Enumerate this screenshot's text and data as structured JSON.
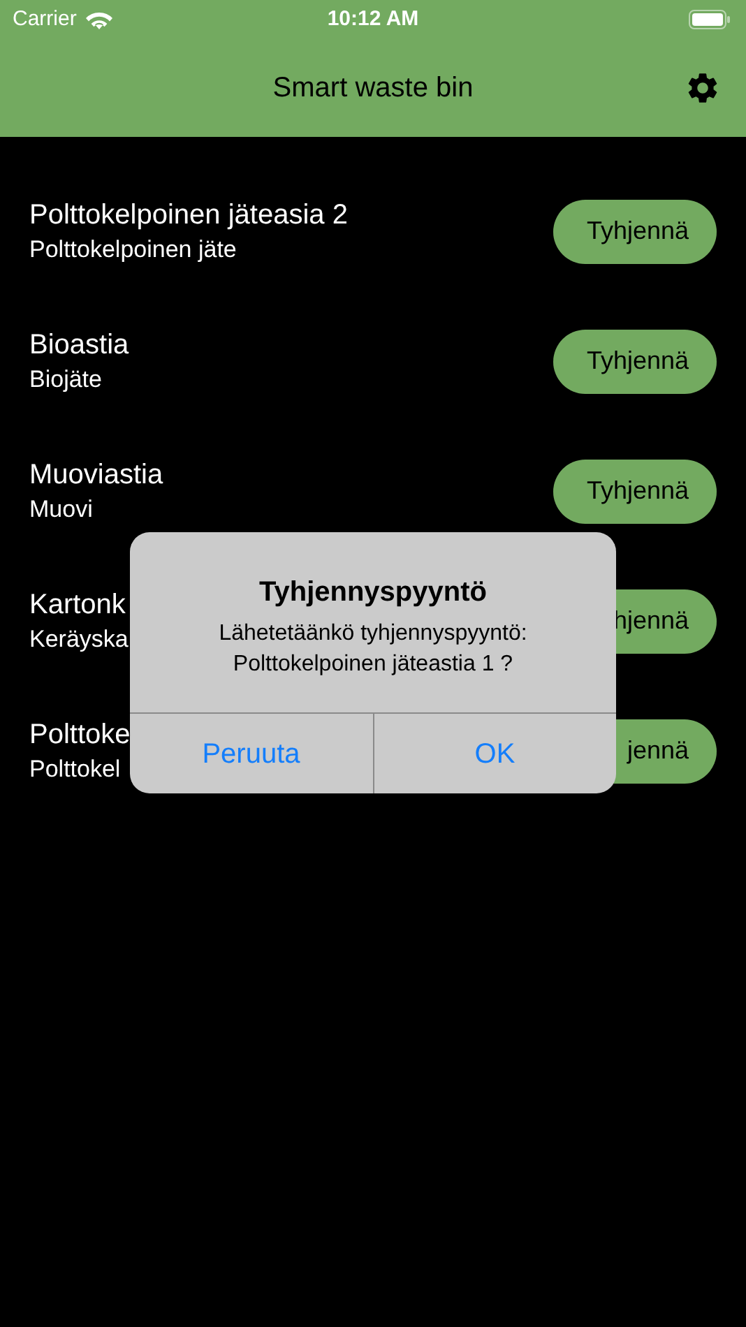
{
  "status_bar": {
    "carrier": "Carrier",
    "time": "10:12 AM"
  },
  "nav_bar": {
    "title": "Smart waste bin"
  },
  "bins": [
    {
      "name": "Polttokelpoinen jäteasia 2",
      "type": "Polttokelpoinen jäte",
      "button": "Tyhjennä"
    },
    {
      "name": "Bioastia",
      "type": "Biojäte",
      "button": "Tyhjennä"
    },
    {
      "name": "Muoviastia",
      "type": "Muovi",
      "button": "Tyhjennä"
    },
    {
      "name": "Kartonk",
      "type": "Keräyska",
      "button": "hjennä"
    },
    {
      "name": "Polttoke",
      "type": "Polttokel",
      "button": "jennä"
    }
  ],
  "alert": {
    "title": "Tyhjennyspyyntö",
    "message_lines": [
      "Lähetetäänkö tyhjennyspyyntö:",
      "Polttokelpoinen jäteastia 1 ?"
    ],
    "buttons": [
      "Peruuta",
      "OK"
    ]
  }
}
